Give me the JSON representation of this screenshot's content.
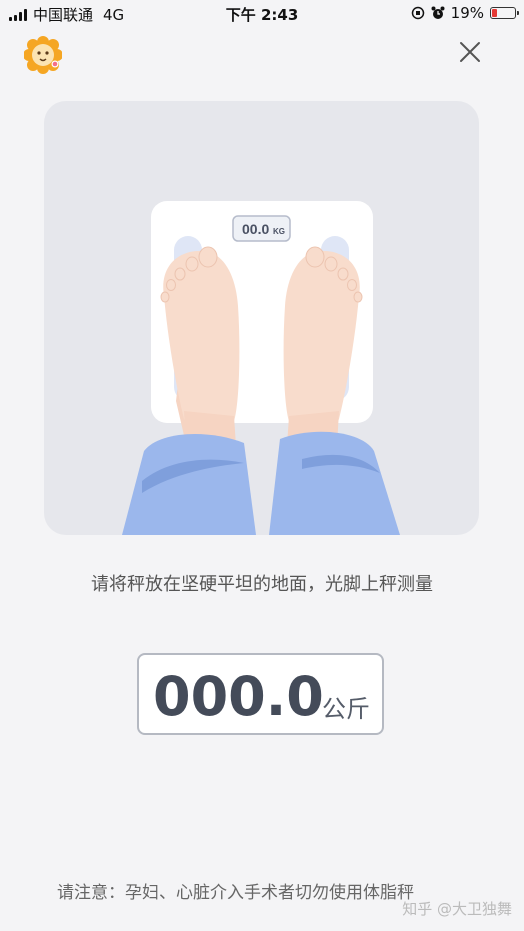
{
  "status_bar": {
    "carrier": "中国联通",
    "network": "4G",
    "time": "下午 2:43",
    "battery_percent": "19%",
    "battery_level": 0.19
  },
  "scale_display": "00.0",
  "scale_unit": "KG",
  "instruction": "请将秤放在坚硬平坦的地面，光脚上秤测量",
  "weight": {
    "value": "000.0",
    "unit": "公斤"
  },
  "notice": "请注意：孕妇、心脏介入手术者切勿使用体脂秤",
  "watermark": "知乎 @大卫独舞",
  "colors": {
    "background": "#f4f4f6",
    "card": "#e6e7ec",
    "pants": "#9bb7ec",
    "skin": "#f8dccc",
    "logo": "#f5a623"
  }
}
